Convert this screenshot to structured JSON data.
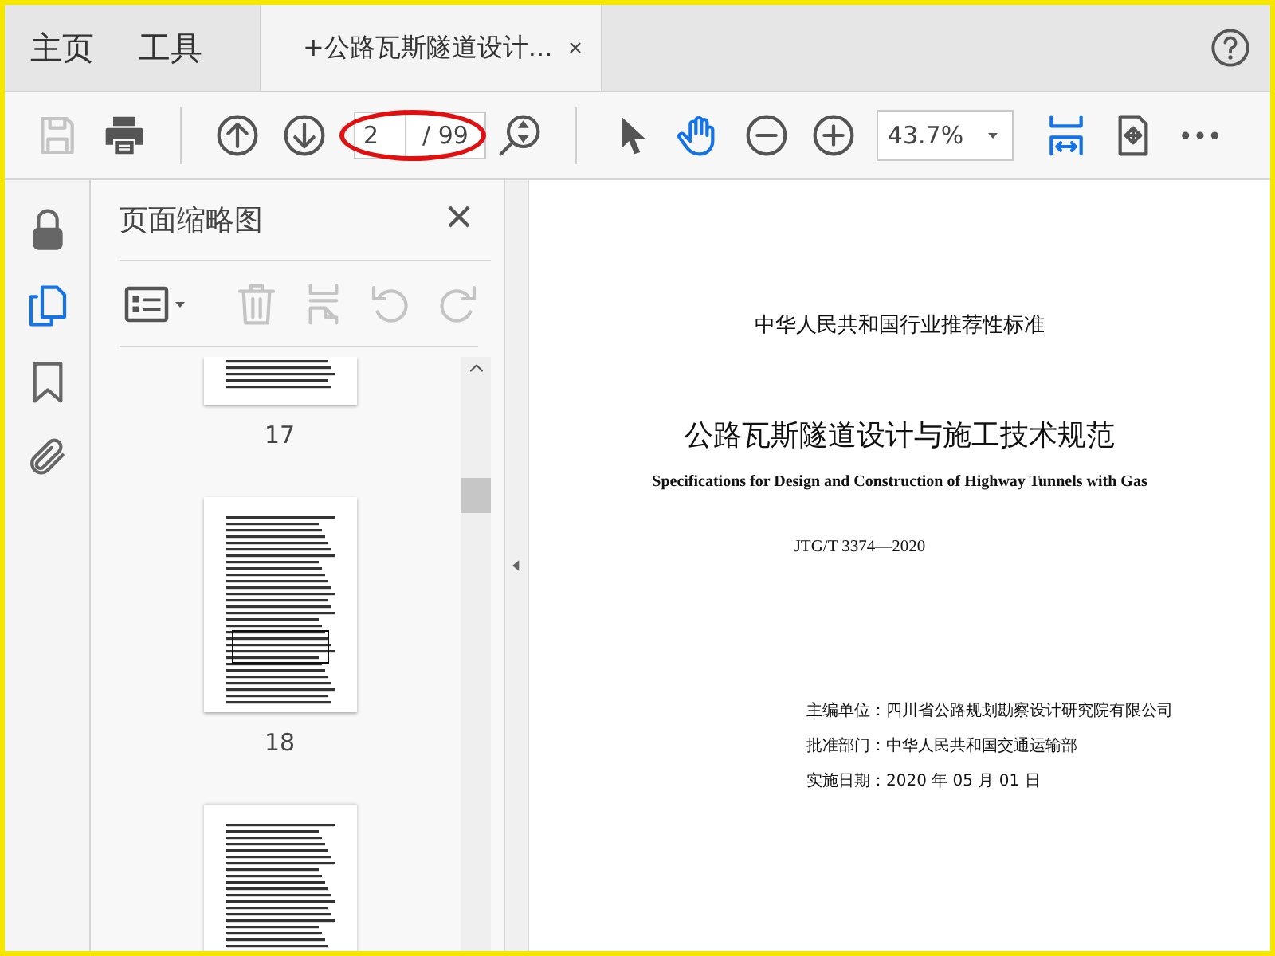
{
  "nav_tabs": [
    {
      "label": "主页",
      "selected": false
    },
    {
      "label": "工具",
      "selected": false
    },
    {
      "label": "+公路瓦斯隧道设计...",
      "selected": true
    }
  ],
  "toolbar": {
    "save": {
      "disabled": true
    },
    "page_field": {
      "value": "2",
      "total": "/ 99"
    },
    "tools": [
      {
        "kind": "pointer",
        "selected": false
      },
      {
        "kind": "hand",
        "selected": true
      }
    ],
    "zoom": {
      "value": "43.7%"
    },
    "view_buttons": [
      {
        "kind": "fit-width",
        "selected": true
      },
      {
        "kind": "full-screen",
        "selected": false
      }
    ]
  },
  "rail": [
    {
      "kind": "lock",
      "selected": false
    },
    {
      "kind": "pages",
      "selected": true
    },
    {
      "kind": "bookmark",
      "selected": false
    },
    {
      "kind": "attachment",
      "selected": false
    }
  ],
  "panel": {
    "title": "页面缩略图",
    "tools": [
      {
        "kind": "delete",
        "disabled": true
      },
      {
        "kind": "insert",
        "disabled": true
      },
      {
        "kind": "undo",
        "disabled": true
      },
      {
        "kind": "redo",
        "disabled": true
      }
    ],
    "thumbnails": [
      {
        "kind": "top-cut",
        "label": "17"
      },
      {
        "kind": "full",
        "label": "18"
      },
      {
        "kind": "bottom-cut"
      }
    ]
  },
  "document": {
    "lines": [
      {
        "kind": "series",
        "text": "中华人民共和国行业推荐性标准"
      },
      {
        "kind": "title",
        "text": "公路瓦斯隧道设计与施工技术规范"
      },
      {
        "kind": "subtitle",
        "text": "Specifications for Design and Construction of Highway Tunnels with Gas"
      },
      {
        "kind": "code",
        "text": "JTG/T 3374—2020"
      },
      {
        "kind": "meta",
        "text": "主编单位：四川省公路规划勘察设计研究院有限公司"
      },
      {
        "kind": "meta",
        "text": "批准部门：中华人民共和国交通运输部"
      },
      {
        "kind": "meta",
        "text": "实施日期：2020 年 05 月 01 日"
      }
    ]
  }
}
